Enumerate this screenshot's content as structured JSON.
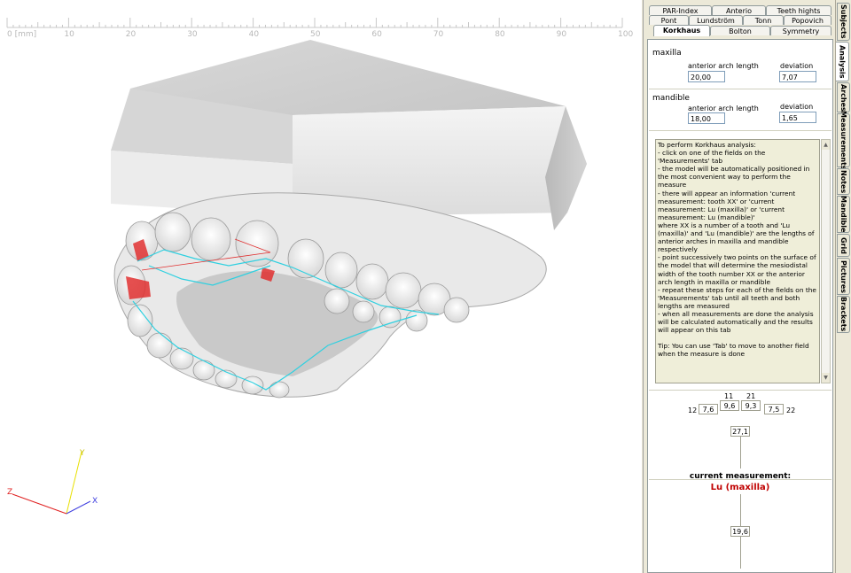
{
  "ruler": {
    "labels": [
      "0 [mm]",
      "10",
      "20",
      "30",
      "40",
      "50",
      "60",
      "70",
      "80",
      "90",
      "100"
    ]
  },
  "axes": {
    "x": "X",
    "y": "Y",
    "z": "Z"
  },
  "vertical_tabs": [
    "Subjects",
    "Analysis",
    "Arches",
    "Measurements",
    "Notes",
    "Mandible",
    "Grid",
    "Pictures",
    "Brackets"
  ],
  "tabs": {
    "row1": [
      "PAR-Index",
      "Anterio",
      "Teeth hights"
    ],
    "row2": [
      "Pont",
      "Lundström",
      "Tonn",
      "Popovich"
    ],
    "row3": [
      "Korkhaus",
      "Bolton",
      "Symmetry"
    ]
  },
  "maxilla": {
    "title": "maxilla",
    "arch_label": "anterior arch length",
    "arch_value": "20,00",
    "dev_label": "deviation",
    "dev_value": "7,07"
  },
  "mandible": {
    "title": "mandible",
    "arch_label": "anterior arch length",
    "arch_value": "18,00",
    "dev_label": "deviation",
    "dev_value": "1,65"
  },
  "info_text": "To perform Korkhaus analysis:\n- click on one of the fields on the 'Measurements' tab\n- the model will be automatically positioned in the most convenient way to perform the measure\n- there will appear an information 'current measurement: tooth XX' or 'current measurement: Lu (maxilla)' or 'current measurement: Lu (mandible)'\nwhere XX is a number of a tooth and 'Lu (maxilla)' and 'Lu (mandible)' are the lengths of anterior arches in maxilla and mandible respectively\n- point successively two points on the surface of the model that will determine the mesiodistal width of the tooth number XX or the anterior arch length in maxilla or mandible\n- repeat these steps for each of the fields on the 'Measurements' tab until all teeth and both lengths are measured\n- when all measurements are done the analysis will be calculated automatically and the results will appear on this tab\n\nTip: You can use 'Tab' to move to another field when the measure is done",
  "teeth": {
    "n12": "12",
    "v12": "7,6",
    "n11": "11",
    "v11": "9,6",
    "n21": "21",
    "v21": "9,3",
    "n22": "22",
    "v22": "7,5",
    "sum": "27,1"
  },
  "current": {
    "label": "current measurement:",
    "value": "Lu (maxilla)",
    "length": "19,6"
  },
  "colors": {
    "measure_line": "#2fd0e0",
    "marker": "#e03030",
    "current_value": "#c00000"
  }
}
